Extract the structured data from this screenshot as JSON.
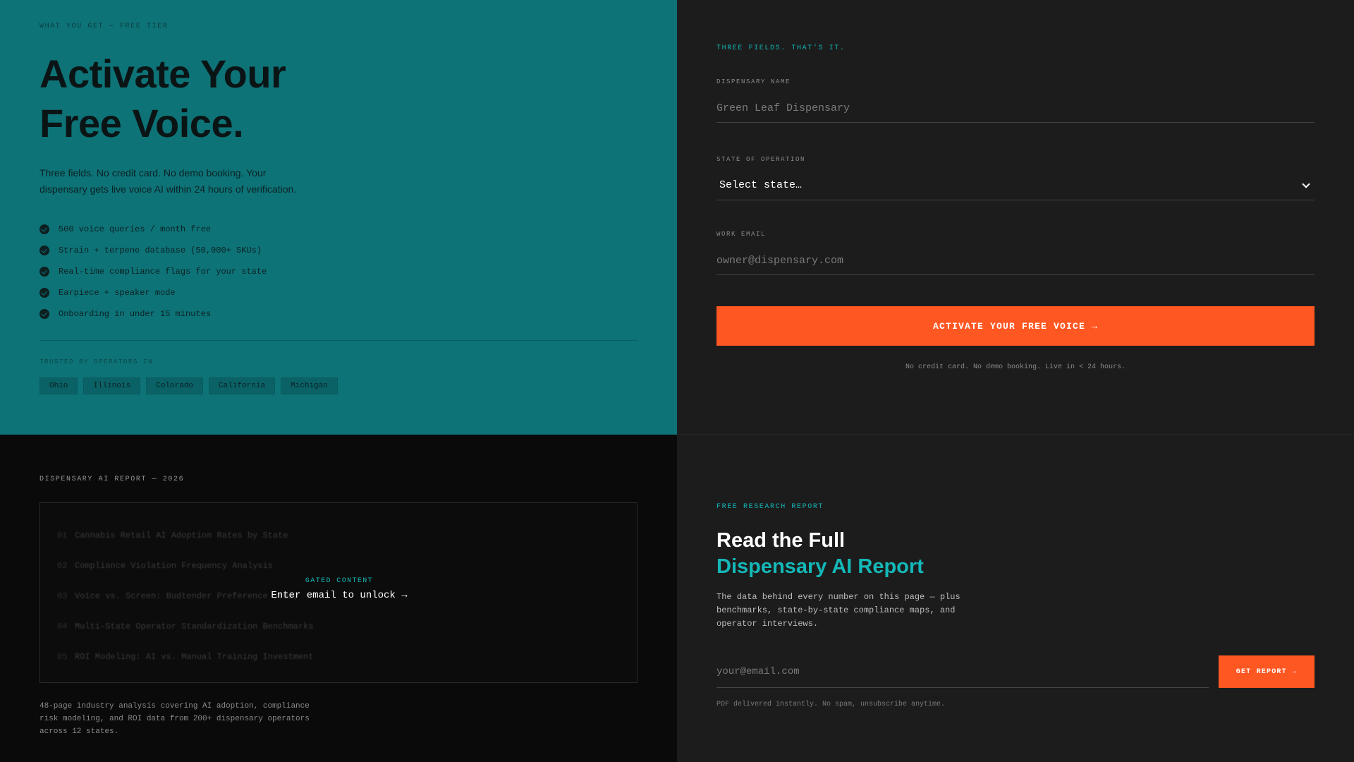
{
  "activation": {
    "kicker": "WHAT YOU GET — FREE TIER",
    "title_line1": "Activate Your",
    "title_line2": "Free Voice.",
    "subtitle": "Three fields. No credit card. No demo booking. Your dispensary gets live voice AI within 24 hours of verification.",
    "features": [
      "500 voice queries / month free",
      "Strain + terpene database (50,000+ SKUs)",
      "Real-time compliance flags for your state",
      "Earpiece + speaker mode",
      "Onboarding in under 15 minutes"
    ],
    "trusted_label": "TRUSTED BY OPERATORS IN",
    "states": [
      "Ohio",
      "Illinois",
      "Colorado",
      "California",
      "Michigan"
    ]
  },
  "form": {
    "kicker": "THREE FIELDS. THAT'S IT.",
    "name_label": "DISPENSARY NAME",
    "name_placeholder": "Green Leaf Dispensary",
    "state_label": "STATE OF OPERATION",
    "state_selected": "Select state…",
    "email_label": "WORK EMAIL",
    "email_placeholder": "owner@dispensary.com",
    "submit_label": "ACTIVATE YOUR FREE VOICE →",
    "note": "No credit card. No demo booking. Live in < 24 hours."
  },
  "report_preview": {
    "kicker": "DISPENSARY AI REPORT — 2026",
    "toc": [
      {
        "num": "01",
        "title": "Cannabis Retail AI Adoption Rates by State"
      },
      {
        "num": "02",
        "title": "Compliance Violation Frequency Analysis"
      },
      {
        "num": "03",
        "title": "Voice vs. Screen: Budtender Preference Study"
      },
      {
        "num": "04",
        "title": "Multi-State Operator Standardization Benchmarks"
      },
      {
        "num": "05",
        "title": "ROI Modeling: AI vs. Manual Training Investment"
      }
    ],
    "gated_label": "GATED CONTENT",
    "gated_link": "Enter email to unlock →",
    "description": "48-page industry analysis covering AI adoption, compliance risk modeling, and ROI data from 200+ dispensary operators across 12 states."
  },
  "report_signup": {
    "kicker": "FREE RESEARCH REPORT",
    "title_line1": "Read the Full",
    "title_line2": "Dispensary AI Report",
    "description": "The data behind every number on this page — plus benchmarks, state-by-state compliance maps, and operator interviews.",
    "email_placeholder": "your@email.com",
    "button_label": "GET REPORT →",
    "note": "PDF delivered instantly. No spam, unsubscribe anytime."
  },
  "colors": {
    "teal_panel": "#0d7377",
    "accent_teal": "#14b8b8",
    "cta_orange": "#ff5722",
    "dark_panel": "#1c1c1c",
    "black_panel": "#0a0a0a"
  },
  "icons": [
    "check-circle-icon",
    "chevron-down-icon"
  ]
}
